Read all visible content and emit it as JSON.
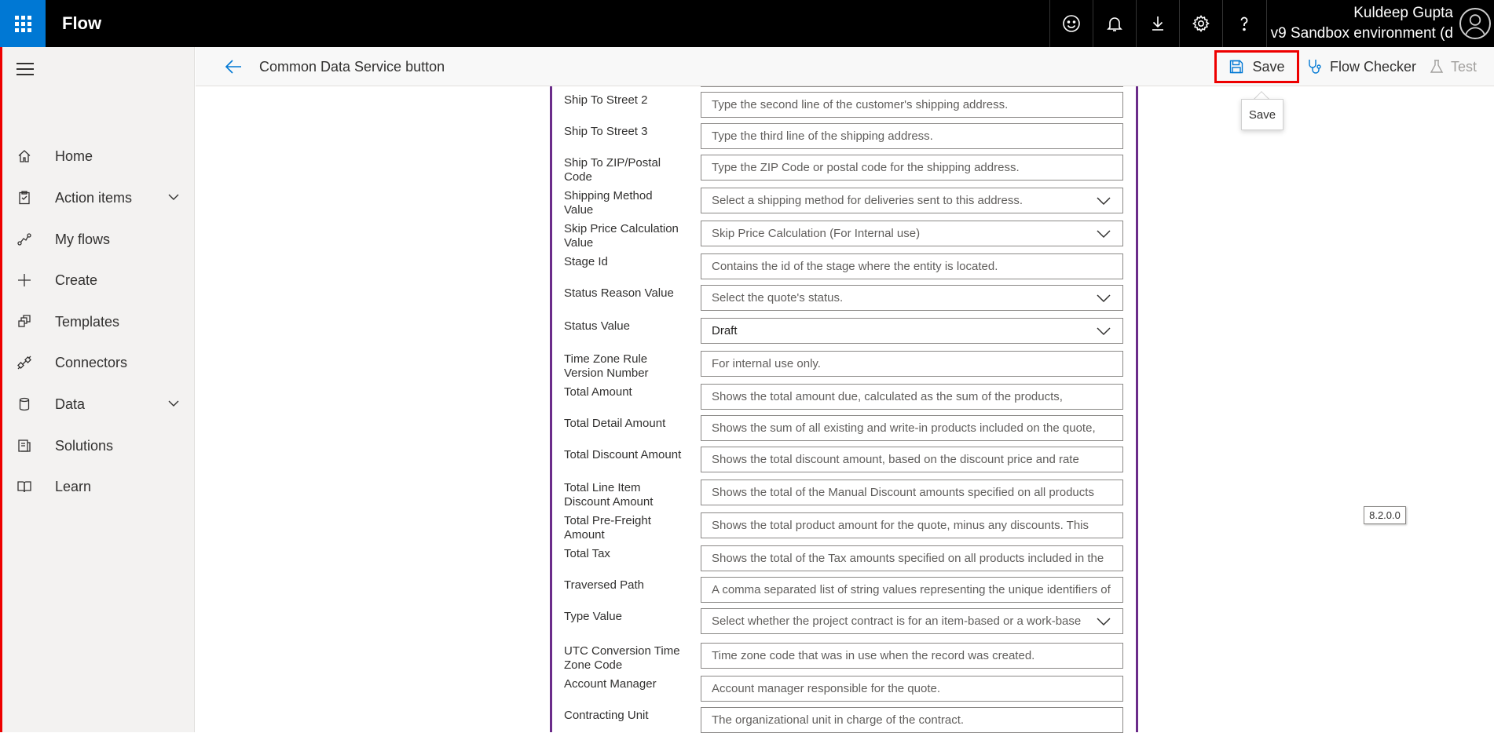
{
  "header": {
    "app_name": "Flow",
    "icons": [
      "smiley-icon",
      "bell-icon",
      "download-icon",
      "gear-icon",
      "help-icon"
    ],
    "user_name": "Kuldeep Gupta",
    "environment": "v9 Sandbox environment (d"
  },
  "sidebar": {
    "items": [
      {
        "label": "Home",
        "icon": "home-icon",
        "expandable": false
      },
      {
        "label": "Action items",
        "icon": "clipboard-icon",
        "expandable": true
      },
      {
        "label": "My flows",
        "icon": "flow-icon",
        "expandable": false
      },
      {
        "label": "Create",
        "icon": "plus-icon",
        "expandable": false
      },
      {
        "label": "Templates",
        "icon": "templates-icon",
        "expandable": false
      },
      {
        "label": "Connectors",
        "icon": "connector-icon",
        "expandable": false
      },
      {
        "label": "Data",
        "icon": "database-icon",
        "expandable": true
      },
      {
        "label": "Solutions",
        "icon": "solutions-icon",
        "expandable": false
      },
      {
        "label": "Learn",
        "icon": "book-icon",
        "expandable": false
      }
    ]
  },
  "command_bar": {
    "title": "Common Data Service button",
    "save_label": "Save",
    "flow_checker_label": "Flow Checker",
    "test_label": "Test",
    "tooltip": "Save"
  },
  "version": "8.2.0.0",
  "fields": [
    {
      "label": "Ship To Street 2",
      "value": "Type the second line of the customer's shipping address.",
      "dropdown": false,
      "filled": false
    },
    {
      "label": "Ship To Street 3",
      "value": "Type the third line of the shipping address.",
      "dropdown": false,
      "filled": false
    },
    {
      "label": "Ship To ZIP/Postal Code",
      "value": "Type the ZIP Code or postal code for the shipping address.",
      "dropdown": false,
      "filled": false
    },
    {
      "label": "Shipping Method Value",
      "value": "Select a shipping method for deliveries sent to this address.",
      "dropdown": true,
      "filled": false
    },
    {
      "label": "Skip Price Calculation Value",
      "value": "Skip Price Calculation (For Internal use)",
      "dropdown": true,
      "filled": false
    },
    {
      "label": "Stage Id",
      "value": "Contains the id of the stage where the entity is located.",
      "dropdown": false,
      "filled": false
    },
    {
      "label": "Status Reason Value",
      "value": "Select the quote's status.",
      "dropdown": true,
      "filled": false
    },
    {
      "label": "Status Value",
      "value": "Draft",
      "dropdown": true,
      "filled": true
    },
    {
      "label": "Time Zone Rule Version Number",
      "value": "For internal use only.",
      "dropdown": false,
      "filled": false
    },
    {
      "label": "Total Amount",
      "value": "Shows the total amount due, calculated as the sum of the products,",
      "dropdown": false,
      "filled": false
    },
    {
      "label": "Total Detail Amount",
      "value": "Shows the sum of all existing and write-in products included on the quote,",
      "dropdown": false,
      "filled": false
    },
    {
      "label": "Total Discount Amount",
      "value": "Shows the total discount amount, based on the discount price and rate",
      "dropdown": false,
      "filled": false
    },
    {
      "label": "Total Line Item Discount Amount",
      "value": "Shows the total of the Manual Discount amounts specified on all products",
      "dropdown": false,
      "filled": false
    },
    {
      "label": "Total Pre-Freight Amount",
      "value": "Shows the total product amount for the quote, minus any discounts. This",
      "dropdown": false,
      "filled": false
    },
    {
      "label": "Total Tax",
      "value": "Shows the total of the Tax amounts specified on all products included in the",
      "dropdown": false,
      "filled": false
    },
    {
      "label": "Traversed Path",
      "value": "A comma separated list of string values representing the unique identifiers of",
      "dropdown": false,
      "filled": false
    },
    {
      "label": "Type Value",
      "value": "Select whether the project contract is for an item-based or a work-base",
      "dropdown": true,
      "filled": false
    },
    {
      "label": "UTC Conversion Time Zone Code",
      "value": "Time zone code that was in use when the record was created.",
      "dropdown": false,
      "filled": false
    },
    {
      "label": "Account Manager",
      "value": "Account manager responsible for the quote.",
      "dropdown": false,
      "filled": false
    },
    {
      "label": "Contracting Unit",
      "value": "The organizational unit in charge of the contract.",
      "dropdown": false,
      "filled": false
    }
  ]
}
